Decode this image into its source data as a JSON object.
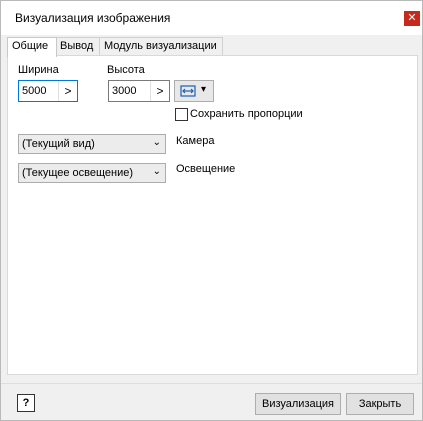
{
  "window": {
    "title": "Визуализация изображения",
    "close_glyph": "✕"
  },
  "tabs": [
    {
      "label": "Общие"
    },
    {
      "label": "Вывод"
    },
    {
      "label": "Модуль визуализации"
    }
  ],
  "size": {
    "width_label": "Ширина",
    "width_value": "5000",
    "height_label": "Высота",
    "height_value": "3000",
    "arrow_glyph": ">"
  },
  "aspect_button": {
    "icon": "width-height-link-icon",
    "dropdown_glyph": "▾"
  },
  "keep_proportions": {
    "label": "Сохранить пропорции",
    "checked": false
  },
  "camera": {
    "selected": "(Текущий вид)",
    "label": "Камера"
  },
  "lighting": {
    "selected": "(Текущее освещение)",
    "label": "Освещение"
  },
  "footer": {
    "help_glyph": "?",
    "render_label": "Визуализация",
    "close_label": "Закрыть"
  },
  "colors": {
    "accent": "#0078d7",
    "close": "#c42b1c",
    "panel": "#ffffff",
    "chrome": "#f0f0f0"
  }
}
